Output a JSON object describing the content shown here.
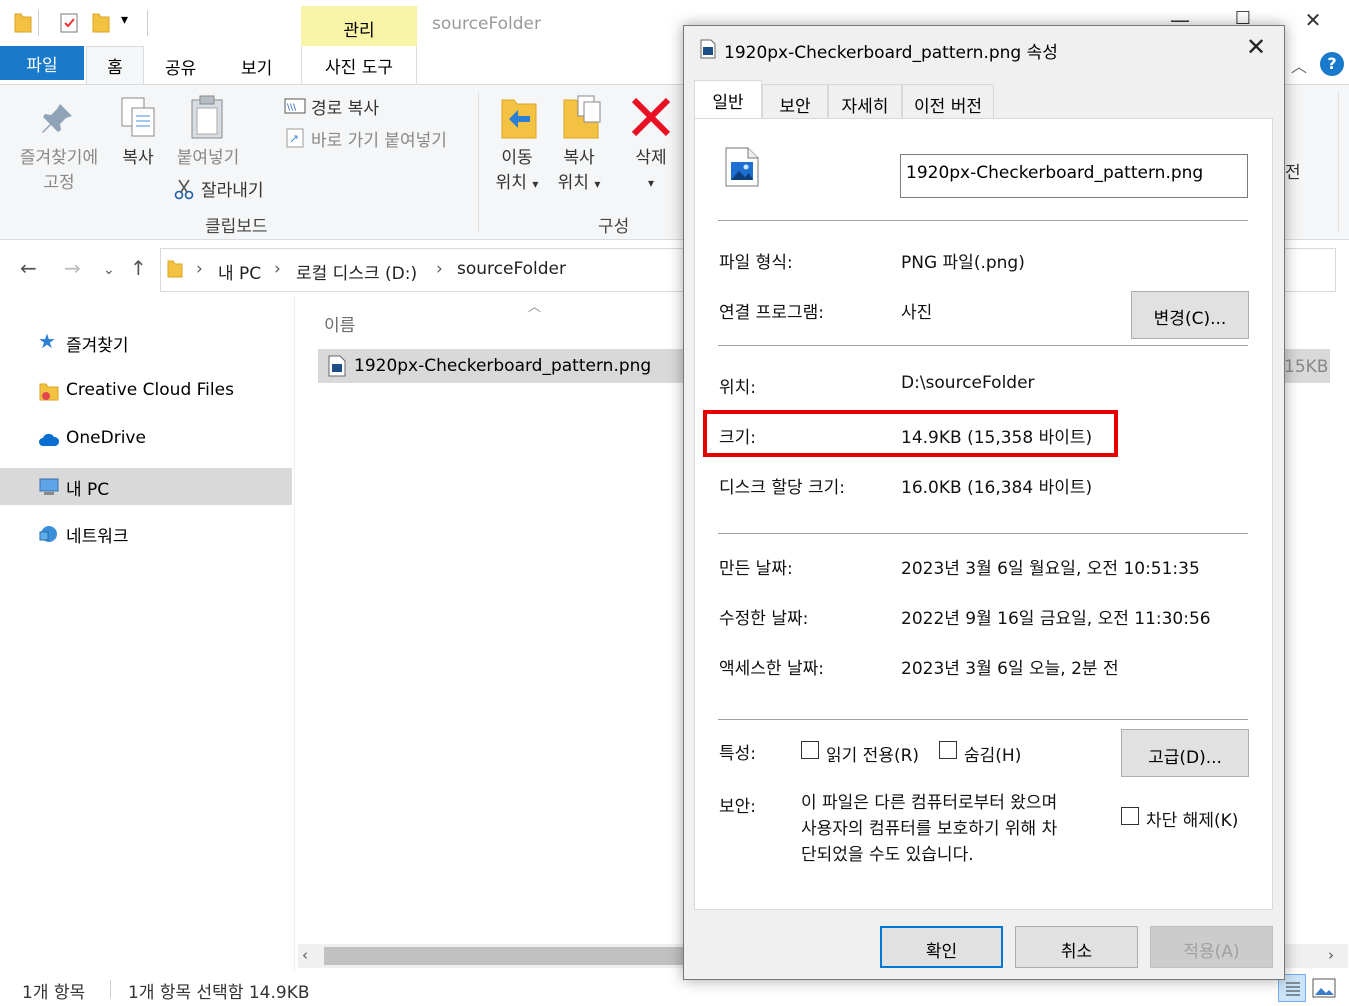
{
  "explorer": {
    "title": "sourceFolder",
    "manage_tab": "관리",
    "ribbon_tabs": {
      "file": "파일",
      "home": "홈",
      "share": "공유",
      "view": "보기",
      "photo_tools": "사진 도구"
    },
    "ribbon": {
      "pin_line1": "즐겨찾기에",
      "pin_line2": "고정",
      "copy": "복사",
      "paste": "붙여넣기",
      "copy_path": "경로 복사",
      "paste_shortcut": "바로 가기 붙여넣기",
      "cut": "잘라내기",
      "clipboard_group": "클립보드",
      "move_line1": "이동",
      "move_line2": "위치",
      "copyto_line1": "복사",
      "copyto_line2": "위치",
      "delete": "삭제",
      "organize_group": "구성",
      "truncated_right": "전"
    },
    "breadcrumb": [
      "내 PC",
      "로컬 디스크 (D:)",
      "sourceFolder"
    ],
    "nav": {
      "favorites": "즐겨찾기",
      "creative_cloud": "Creative Cloud Files",
      "onedrive": "OneDrive",
      "this_pc": "내 PC",
      "network": "네트워크"
    },
    "column_name": "이름",
    "file": {
      "name": "1920px-Checkerboard_pattern.png",
      "size_truncated": "15KB"
    },
    "status": {
      "count": "1개 항목",
      "selected": "1개 항목 선택함 14.9KB"
    }
  },
  "dialog": {
    "title": "1920px-Checkerboard_pattern.png 속성",
    "tabs": [
      "일반",
      "보안",
      "자세히",
      "이전 버전"
    ],
    "filename": "1920px-Checkerboard_pattern.png",
    "props": {
      "type_label": "파일 형식:",
      "type_value": "PNG 파일(.png)",
      "opens_label": "연결 프로그램:",
      "opens_value": "사진",
      "change_button": "변경(C)...",
      "location_label": "위치:",
      "location_value": "D:\\sourceFolder",
      "size_label": "크기:",
      "size_value": "14.9KB (15,358 바이트)",
      "disk_label": "디스크 할당 크기:",
      "disk_value": "16.0KB (16,384 바이트)",
      "created_label": "만든 날짜:",
      "created_value": "2023년 3월 6일 월요일, 오전 10:51:35",
      "modified_label": "수정한 날짜:",
      "modified_value": "2022년 9월 16일 금요일, 오전 11:30:56",
      "accessed_label": "액세스한 날짜:",
      "accessed_value": "2023년 3월 6일 오늘, 2분 전",
      "attr_label": "특성:",
      "readonly": "읽기 전용(R)",
      "hidden": "숨김(H)",
      "advanced_button": "고급(D)...",
      "security_label": "보안:",
      "security_line1": "이 파일은 다른 컴퓨터로부터 왔으며",
      "security_line2": "사용자의 컴퓨터를 보호하기 위해 차",
      "security_line3": "단되었을 수도 있습니다.",
      "unblock": "차단 해제(K)"
    },
    "buttons": {
      "ok": "확인",
      "cancel": "취소",
      "apply": "적용(A)"
    }
  },
  "colors": {
    "accent": "#1979ca",
    "highlight": "#e80000",
    "manage_tab_bg": "#f7f3a7"
  }
}
